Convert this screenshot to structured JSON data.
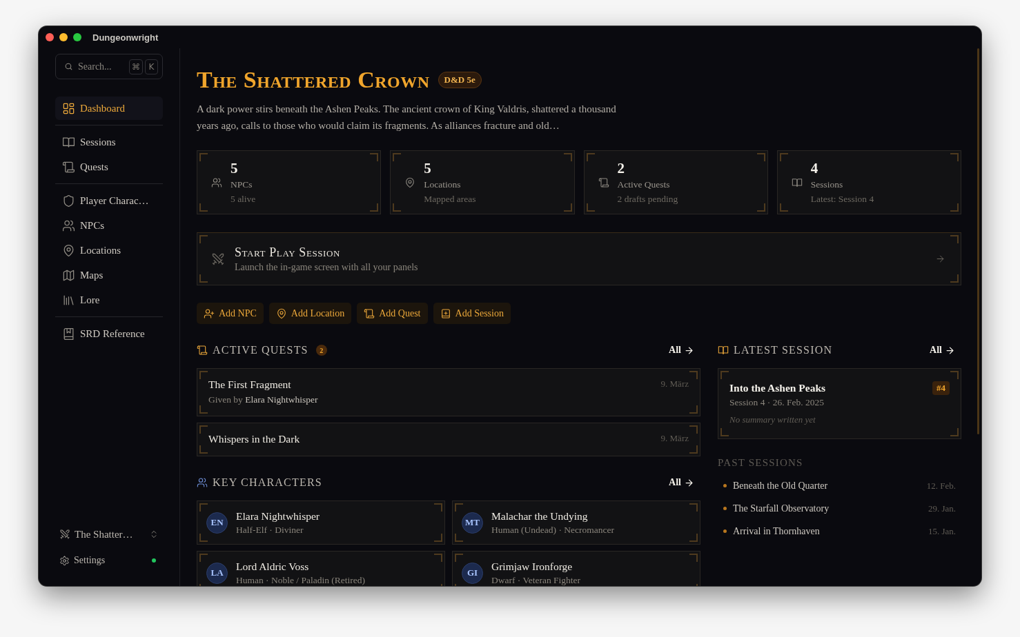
{
  "window": {
    "title": "Dungeonwright"
  },
  "sidebar": {
    "search": {
      "placeholder": "Search...",
      "shortcut": [
        "⌘",
        "K"
      ]
    },
    "groups": [
      [
        {
          "label": "Dashboard",
          "selected": true
        }
      ],
      [
        {
          "label": "Sessions",
          "selected": false
        },
        {
          "label": "Quests",
          "selected": false
        }
      ],
      [
        {
          "label": "Player Charac…",
          "selected": false
        },
        {
          "label": "NPCs",
          "selected": false
        },
        {
          "label": "Locations",
          "selected": false
        },
        {
          "label": "Maps",
          "selected": false
        },
        {
          "label": "Lore",
          "selected": false
        }
      ],
      [
        {
          "label": "SRD Reference",
          "selected": false
        }
      ]
    ],
    "campaign": {
      "label": "The Shatter…"
    },
    "settings": {
      "label": "Settings",
      "online": true
    }
  },
  "header": {
    "title": "The Shattered Crown",
    "badge": "D&D 5e",
    "description": "A dark power stirs beneath the Ashen Peaks. The ancient crown of King Valdris, shattered a thousand years ago, calls to those who would claim its fragments. As alliances fracture and old…"
  },
  "stats": [
    {
      "value": "5",
      "label": "NPCs",
      "detail": "5 alive"
    },
    {
      "value": "5",
      "label": "Locations",
      "detail": "Mapped areas"
    },
    {
      "value": "2",
      "label": "Active Quests",
      "detail": "2 drafts pending"
    },
    {
      "value": "4",
      "label": "Sessions",
      "detail": "Latest: Session 4"
    }
  ],
  "play": {
    "title": "Start Play Session",
    "subtitle": "Launch the in-game screen with all your panels"
  },
  "actions": [
    "Add NPC",
    "Add Location",
    "Add Quest",
    "Add Session"
  ],
  "active_quests": {
    "title": "ACTIVE QUESTS",
    "count": "2",
    "link": "All",
    "items": [
      {
        "title": "The First Fragment",
        "date": "9. März",
        "given_by_label": "Given by",
        "given_by": "Elara Nightwhisper"
      },
      {
        "title": "Whispers in the Dark",
        "date": "9. März"
      }
    ]
  },
  "key_characters": {
    "title": "KEY CHARACTERS",
    "link": "All",
    "items": [
      {
        "initials": "EN",
        "name": "Elara Nightwhisper",
        "details": "Half-Elf · Diviner"
      },
      {
        "initials": "MT",
        "name": "Malachar the Undying",
        "details": "Human (Undead) · Necromancer"
      },
      {
        "initials": "LA",
        "name": "Lord Aldric Voss",
        "details": "Human · Noble / Paladin (Retired)"
      },
      {
        "initials": "GI",
        "name": "Grimjaw Ironforge",
        "details": "Dwarf · Veteran Fighter"
      }
    ]
  },
  "latest_session": {
    "title": "LATEST SESSION",
    "link": "All",
    "card": {
      "title": "Into the Ashen Peaks",
      "number": "#4",
      "meta": "Session 4 · 26. Feb. 2025",
      "summary": "No summary written yet"
    }
  },
  "past_sessions": {
    "title": "PAST SESSIONS",
    "items": [
      {
        "title": "Beneath the Old Quarter",
        "date": "12. Feb."
      },
      {
        "title": "The Starfall Observatory",
        "date": "29. Jan."
      },
      {
        "title": "Arrival in Thornhaven",
        "date": "15. Jan."
      }
    ]
  }
}
